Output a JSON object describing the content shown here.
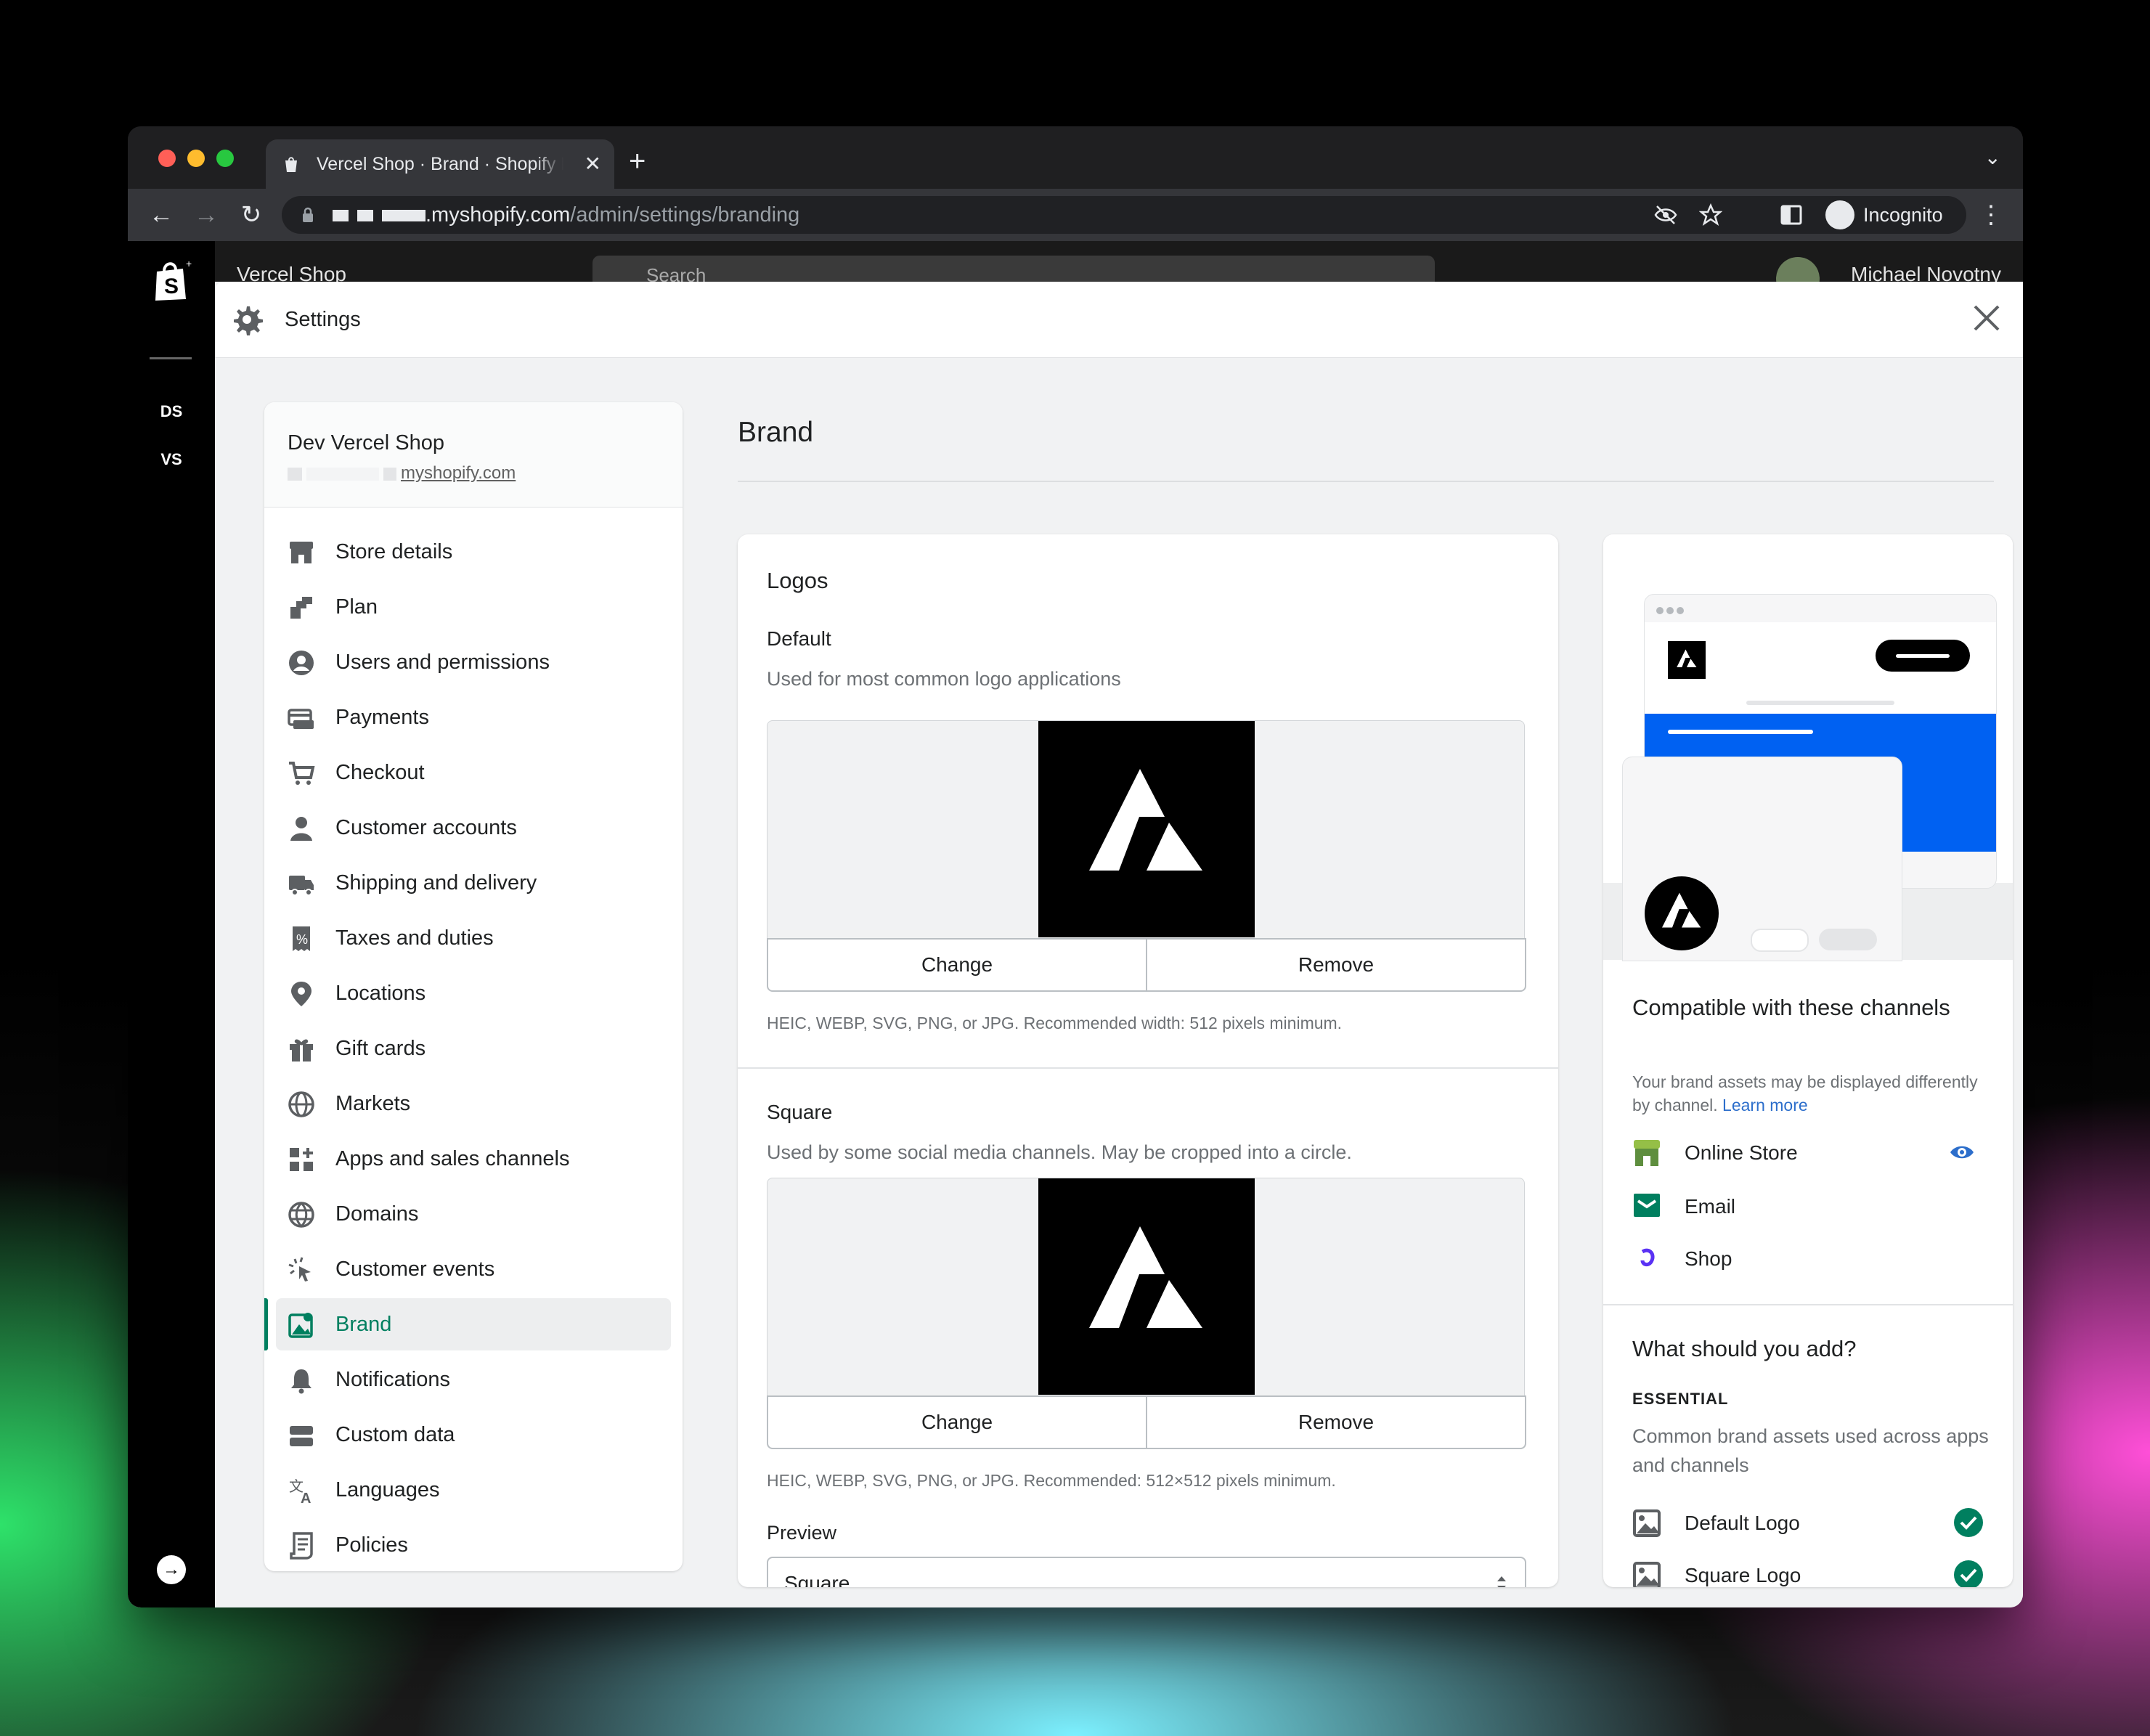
{
  "browser": {
    "tab_title": "Vercel Shop · Brand · Shopify P",
    "url_host": ".myshopify.com",
    "url_path": "/admin/settings/branding",
    "incognito_label": "Incognito"
  },
  "admin": {
    "rail_initials": [
      "DS",
      "VS"
    ],
    "store_name": "Vercel Shop",
    "search_placeholder": "Search",
    "user_name": "Michael Novotny"
  },
  "settings": {
    "header_title": "Settings",
    "store": {
      "name": "Dev Vercel Shop",
      "domain": "myshopify.com"
    },
    "nav": [
      {
        "label": "Store details",
        "icon": "store-icon"
      },
      {
        "label": "Plan",
        "icon": "plan-icon"
      },
      {
        "label": "Users and permissions",
        "icon": "user-circle-icon"
      },
      {
        "label": "Payments",
        "icon": "payments-icon"
      },
      {
        "label": "Checkout",
        "icon": "cart-icon"
      },
      {
        "label": "Customer accounts",
        "icon": "person-icon"
      },
      {
        "label": "Shipping and delivery",
        "icon": "truck-icon"
      },
      {
        "label": "Taxes and duties",
        "icon": "receipt-icon"
      },
      {
        "label": "Locations",
        "icon": "location-pin-icon"
      },
      {
        "label": "Gift cards",
        "icon": "gift-icon"
      },
      {
        "label": "Markets",
        "icon": "globe-icon"
      },
      {
        "label": "Apps and sales channels",
        "icon": "apps-icon"
      },
      {
        "label": "Domains",
        "icon": "domain-globe-icon"
      },
      {
        "label": "Customer events",
        "icon": "cursor-click-icon"
      },
      {
        "label": "Brand",
        "icon": "brand-icon",
        "active": true
      },
      {
        "label": "Notifications",
        "icon": "bell-icon"
      },
      {
        "label": "Custom data",
        "icon": "database-icon"
      },
      {
        "label": "Languages",
        "icon": "translate-icon"
      },
      {
        "label": "Policies",
        "icon": "document-icon"
      }
    ]
  },
  "brand": {
    "page_title": "Brand",
    "logos": {
      "heading": "Logos",
      "default": {
        "title": "Default",
        "description": "Used for most common logo applications",
        "change_label": "Change",
        "remove_label": "Remove",
        "help": "HEIC, WEBP, SVG, PNG, or JPG. Recommended width: 512 pixels minimum."
      },
      "square": {
        "title": "Square",
        "description": "Used by some social media channels. May be cropped into a circle.",
        "change_label": "Change",
        "remove_label": "Remove",
        "help": "HEIC, WEBP, SVG, PNG, or JPG. Recommended: 512×512 pixels minimum."
      },
      "preview_label": "Preview",
      "preview_value": "Square"
    },
    "channels": {
      "heading": "Compatible with these channels",
      "description": "Your brand assets may be displayed differently by channel.",
      "learn_more": "Learn more",
      "items": [
        {
          "label": "Online Store",
          "icon": "online-store-icon"
        },
        {
          "label": "Email",
          "icon": "email-icon"
        },
        {
          "label": "Shop",
          "icon": "shop-app-icon"
        }
      ]
    },
    "add": {
      "heading": "What should you add?",
      "section_label": "ESSENTIAL",
      "section_description": "Common brand assets used across apps and channels",
      "items": [
        {
          "label": "Default Logo",
          "status": "complete"
        },
        {
          "label": "Square Logo",
          "status": "complete"
        }
      ]
    }
  },
  "colors": {
    "accent_green": "#007f5f",
    "link_blue": "#2c6ecb",
    "preview_blue": "#0061f2"
  }
}
